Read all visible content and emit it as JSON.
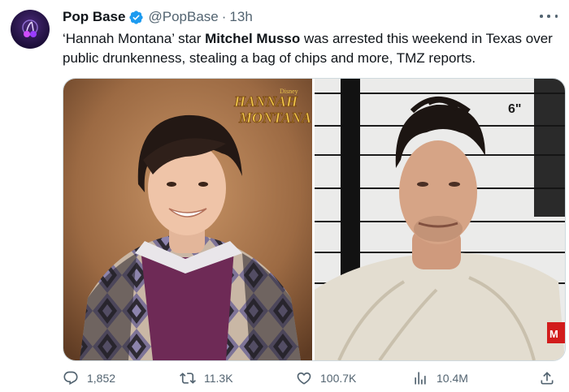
{
  "tweet": {
    "author_name": "Pop Base",
    "handle": "@PopBase",
    "separator": "·",
    "time": "13h",
    "text_parts": [
      "‘Hannah Montana’ star ",
      "Mitchel Musso",
      " was arrested this weekend in Texas over public drunkenness, stealing a bag of chips and more, TMZ reports."
    ]
  },
  "media": {
    "left_logo": {
      "small": "Disney",
      "line1": "HANNAH",
      "line2": "MONTANA"
    },
    "right_height_marker": "6\"",
    "right_badge": "M"
  },
  "actions": {
    "replies": "1,852",
    "reposts": "11.3K",
    "likes": "100.7K",
    "views": "10.4M"
  },
  "colors": {
    "text": "#0f1419",
    "secondary": "#536471",
    "verified": "#1d9bf0",
    "border": "#cfd9de"
  },
  "icons": [
    "more-icon",
    "verified-badge-icon",
    "reply-icon",
    "repost-icon",
    "like-icon",
    "views-icon",
    "share-icon"
  ]
}
